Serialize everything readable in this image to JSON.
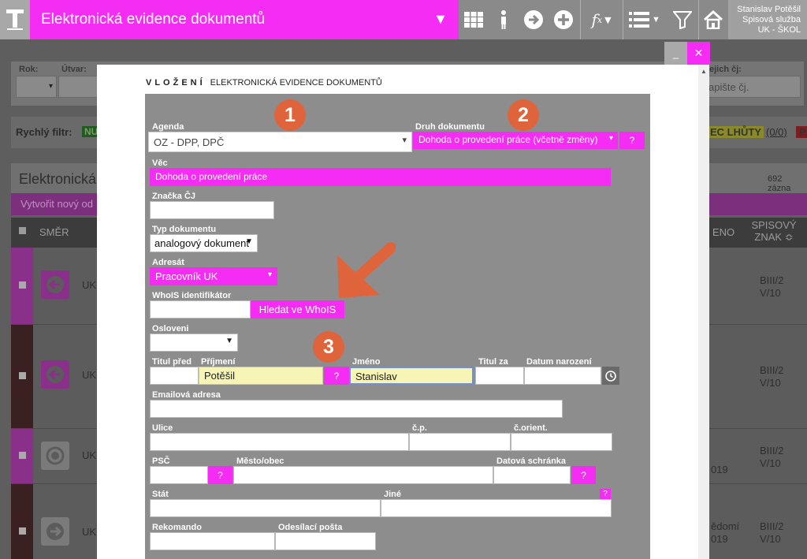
{
  "app": {
    "title": "Elektronická evidence dokumentů",
    "user_line1": "Stanislav Potěšil",
    "user_line2": "Spisová služba",
    "user_line3": "UK - ŠKOL"
  },
  "background": {
    "rok_label": "Rok:",
    "utvar_label": "Útvar:",
    "cislo_label": "ejich čj:",
    "cislo_placeholder": "apište čj.",
    "quick_filter_label": "Rychlý filtr:",
    "quick_filter_tag": "NU",
    "lhuty_tag": "EC LHŮTY",
    "lhuty_count": "(0/0)",
    "p_tag": "P",
    "list_title": "Elektronická",
    "record_count": "692 zázna",
    "create_label": "Vytvořit nový od",
    "col_smer": "SMĚR",
    "col_eno": "ENO",
    "col_spisovy": "SPISOVÝ",
    "col_znak": "ZNAK ≎",
    "rows": [
      {
        "uk": "UK",
        "sz1": "BIII/2",
        "sz2": "V/10",
        "dt1": "",
        "dt2": ""
      },
      {
        "uk": "UK",
        "sz1": "BIII/2",
        "sz2": "V/10",
        "dt1": "",
        "dt2": ""
      },
      {
        "uk": "UK",
        "sz1": "BIII/2",
        "sz2": "V/10",
        "dt1": "",
        "dt2": "019"
      },
      {
        "uk": "UK",
        "sz1": "BIII/2",
        "sz2": "V/10",
        "dt1": "ědomí",
        "dt2": "019"
      }
    ]
  },
  "modal": {
    "minimize": "_",
    "close": "✕",
    "header_bold": "VLOŽENÍ",
    "header_rest": "ELEKTRONICKÁ EVIDENCE DOKUMENTŮ"
  },
  "form": {
    "agenda_label": "Agenda",
    "agenda_value": "OZ - DPP, DPČ",
    "druh_label": "Druh dokumentu",
    "druh_value": "Dohoda o provedení práce (včetně změny)",
    "vec_label": "Věc",
    "vec_value": "Dohoda o provedení práce",
    "znacka_label": "Značka ČJ",
    "typ_label": "Typ dokumentu",
    "typ_value": "analogový dokument",
    "adresat_label": "Adresát",
    "adresat_value": "Pracovník UK",
    "whois_label": "WhoIS identifikátor",
    "whois_button": "Hledat ve WhoIS",
    "osloveni_label": "Osloveni",
    "titul_pred_label": "Titul před",
    "prijmeni_label": "Příjmení",
    "prijmeni_value": "Potěšil",
    "jmeno_label": "Jméno",
    "jmeno_value": "Stanislav",
    "titul_za_label": "Titul za",
    "datum_label": "Datum narození",
    "email_label": "Emailová adresa",
    "ulice_label": "Ulice",
    "cp_label": "č.p.",
    "corient_label": "č.orient.",
    "psc_label": "PSČ",
    "mesto_label": "Město/obec",
    "datova_label": "Datová schránka",
    "stat_label": "Stát",
    "jine_label": "Jiné",
    "rekomando_label": "Rekomando",
    "posta_label": "Odesílací pošta",
    "help": "?"
  },
  "annotations": {
    "badge1": "1",
    "badge2": "2",
    "badge3": "3"
  },
  "colors": {
    "accent": "#f52df4",
    "badge": "#e0643b",
    "form_bg": "#8d8d8d"
  }
}
